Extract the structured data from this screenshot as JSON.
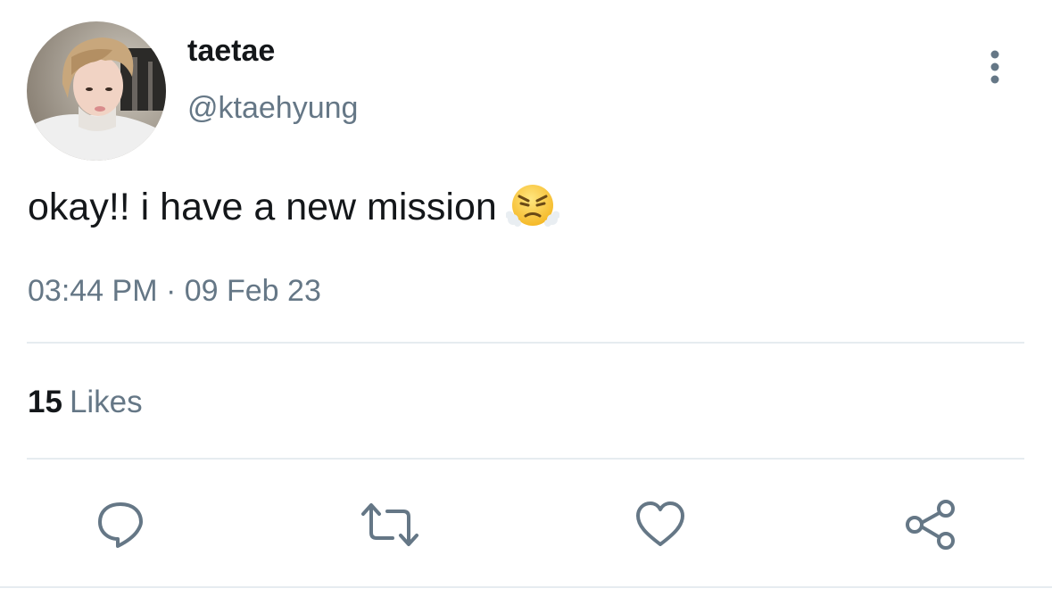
{
  "tweet": {
    "author": {
      "display_name": "taetae",
      "handle": "@ktaehyung"
    },
    "text": "okay!! i have a new mission",
    "emoji": "face-with-steam-from-nose-emoji",
    "timestamp": "03:44 PM · 09 Feb 23",
    "likes": {
      "count": "15",
      "label": "Likes"
    }
  },
  "actions": {
    "reply_icon": "reply-icon",
    "retweet_icon": "retweet-icon",
    "like_icon": "heart-icon",
    "share_icon": "share-icon",
    "more_icon": "more-vertical-icon"
  },
  "colors": {
    "text_primary": "#14171a",
    "text_secondary": "#657786",
    "divider": "#e6ecf0",
    "icon": "#657786"
  }
}
